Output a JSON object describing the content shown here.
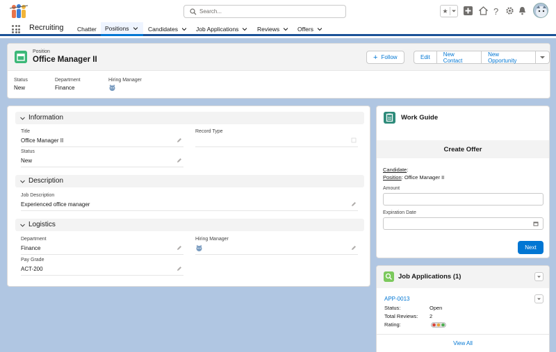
{
  "header": {
    "search_placeholder": "Search..."
  },
  "nav": {
    "app_name": "Recruiting",
    "items": [
      {
        "label": "Chatter"
      },
      {
        "label": "Positions"
      },
      {
        "label": "Candidates"
      },
      {
        "label": "Job Applications"
      },
      {
        "label": "Reviews"
      },
      {
        "label": "Offers"
      }
    ]
  },
  "record": {
    "object_label": "Position",
    "name": "Office Manager II",
    "actions": {
      "follow": "Follow",
      "edit": "Edit",
      "new_contact": "New Contact",
      "new_opportunity": "New Opportunity"
    },
    "highlights": {
      "status_label": "Status",
      "status_value": "New",
      "department_label": "Department",
      "department_value": "Finance",
      "hiring_manager_label": "Hiring Manager"
    }
  },
  "detail": {
    "information": {
      "title": "Information",
      "title_label": "Title",
      "title_value": "Office Manager II",
      "record_type_label": "Record Type",
      "status_label": "Status",
      "status_value": "New"
    },
    "description": {
      "title": "Description",
      "job_description_label": "Job Description",
      "job_description_value": "Experienced office manager"
    },
    "logistics": {
      "title": "Logistics",
      "department_label": "Department",
      "department_value": "Finance",
      "hiring_manager_label": "Hiring Manager",
      "pay_grade_label": "Pay Grade",
      "pay_grade_value": "ACT-200"
    }
  },
  "work_guide": {
    "title": "Work Guide",
    "step_title": "Create Offer",
    "candidate_label": "Candidate",
    "position_label": "Position",
    "position_value": "Office Manager II",
    "amount_label": "Amount",
    "expiration_label": "Expiration Date",
    "next_label": "Next"
  },
  "job_applications": {
    "title": "Job Applications (1)",
    "record_link": "APP-0013",
    "status_label": "Status:",
    "status_value": "Open",
    "total_reviews_label": "Total Reviews:",
    "total_reviews_value": "2",
    "rating_label": "Rating:",
    "view_all": "View All"
  },
  "colors": {
    "brand_blue": "#0176d3",
    "nav_bar": "#1b5297",
    "background_band": "#b0c6e2",
    "position_icon": "#3cb878",
    "work_guide_icon": "#2e8b7a",
    "job_app_icon": "#7cc95d"
  },
  "icons": [
    "app-logo-icon",
    "search-icon",
    "star-icon",
    "plus-icon",
    "home-icon",
    "help-icon",
    "gear-icon",
    "bell-icon",
    "user-avatar",
    "waffle-icon",
    "chevron-down-icon",
    "pencil-icon",
    "calendar-icon",
    "clipboard-icon",
    "rating-lights-icon"
  ]
}
